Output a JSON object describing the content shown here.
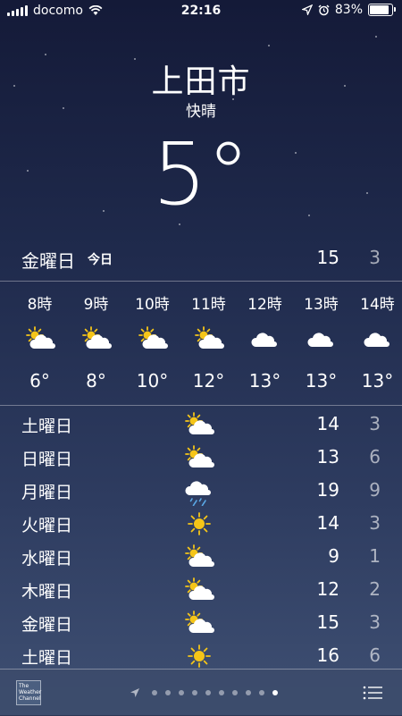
{
  "status_bar": {
    "carrier": "docomo",
    "time": "22:16",
    "battery": "83%"
  },
  "location": {
    "city": "上田市",
    "condition": "快晴",
    "temperature": "5°"
  },
  "today": {
    "day": "金曜日",
    "label": "今日",
    "high": "15",
    "low": "3"
  },
  "hourly": [
    {
      "hour": "8時",
      "icon": "partly-cloudy-icon",
      "temp": "6°"
    },
    {
      "hour": "9時",
      "icon": "partly-cloudy-icon",
      "temp": "8°"
    },
    {
      "hour": "10時",
      "icon": "partly-cloudy-icon",
      "temp": "10°"
    },
    {
      "hour": "11時",
      "icon": "partly-cloudy-icon",
      "temp": "12°"
    },
    {
      "hour": "12時",
      "icon": "cloud-icon",
      "temp": "13°"
    },
    {
      "hour": "13時",
      "icon": "cloud-icon",
      "temp": "13°"
    },
    {
      "hour": "14時",
      "icon": "cloud-icon",
      "temp": "13°"
    }
  ],
  "daily": [
    {
      "day": "土曜日",
      "icon": "partly-cloudy-icon",
      "high": "14",
      "low": "3"
    },
    {
      "day": "日曜日",
      "icon": "partly-cloudy-icon",
      "high": "13",
      "low": "6"
    },
    {
      "day": "月曜日",
      "icon": "rain-icon",
      "high": "19",
      "low": "9"
    },
    {
      "day": "火曜日",
      "icon": "sun-icon",
      "high": "14",
      "low": "3"
    },
    {
      "day": "水曜日",
      "icon": "partly-cloudy-icon",
      "high": "9",
      "low": "1"
    },
    {
      "day": "木曜日",
      "icon": "partly-cloudy-icon",
      "high": "12",
      "low": "2"
    },
    {
      "day": "金曜日",
      "icon": "partly-cloudy-icon",
      "high": "15",
      "low": "3"
    },
    {
      "day": "土曜日",
      "icon": "sun-icon",
      "high": "16",
      "low": "6"
    }
  ],
  "bottom_bar": {
    "logo_text": "The Weather Channel",
    "page_count": 10,
    "active_page": 10
  },
  "colors": {
    "sun": "#f5c518",
    "cloud": "#ffffff",
    "rain": "#5aa9e6"
  }
}
